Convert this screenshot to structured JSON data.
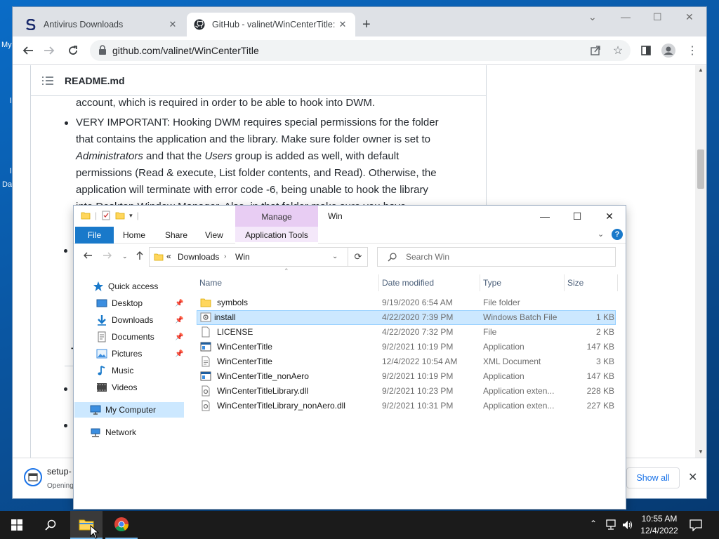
{
  "desktop": {
    "fragments": [
      "My",
      "l",
      "l",
      "Da"
    ]
  },
  "browser": {
    "tabs": [
      {
        "title": "Antivirus Downloads",
        "active": false
      },
      {
        "title": "GitHub - valinet/WinCenterTitle:",
        "active": true
      }
    ],
    "address": "github.com/valinet/WinCenterTitle",
    "readme": {
      "filename": "README.md",
      "lines": [
        "account, which is required in order to be able to hook into DWM.",
        "VERY IMPORTANT: Hooking DWM requires special permissions for the folder",
        "that contains the application and the library. Make sure folder owner is set to",
        "permissions (Read & execute, List folder contents, and Read). Otherwise, the",
        "application will terminate with error code -6, being unable to hook the library"
      ],
      "line3": {
        "em1": "Administrators",
        "mid": " and that the ",
        "em2": "Users",
        "end": " group is added as well, with default"
      },
      "partial_line": "into Desktop Window Manager. Also, in that folder make sure you have",
      "heading_fragment": "To"
    },
    "download": {
      "filename": "setup-",
      "status": "Opening",
      "show_all": "Show all"
    }
  },
  "explorer": {
    "window_title": "Win",
    "context_tab": "Manage",
    "ribbon_tabs": [
      "File",
      "Home",
      "Share",
      "View",
      "Application Tools"
    ],
    "breadcrumb": {
      "overflow": "«",
      "items": [
        "Downloads",
        "Win"
      ]
    },
    "search_placeholder": "Search Win",
    "nav": {
      "quick_access": "Quick access",
      "items": [
        {
          "label": "Desktop",
          "pinned": true
        },
        {
          "label": "Downloads",
          "pinned": true
        },
        {
          "label": "Documents",
          "pinned": true
        },
        {
          "label": "Pictures",
          "pinned": true
        },
        {
          "label": "Music",
          "pinned": false
        },
        {
          "label": "Videos",
          "pinned": false
        }
      ],
      "my_computer": "My Computer",
      "network": "Network"
    },
    "columns": [
      "Name",
      "Date modified",
      "Type",
      "Size"
    ],
    "files": [
      {
        "name": "symbols",
        "date": "9/19/2020 6:54 AM",
        "type": "File folder",
        "size": "",
        "icon": "folder-icon"
      },
      {
        "name": "install",
        "date": "4/22/2020 7:39 PM",
        "type": "Windows Batch File",
        "size": "1 KB",
        "icon": "batch-file-icon",
        "selected": true
      },
      {
        "name": "LICENSE",
        "date": "4/22/2020 7:32 PM",
        "type": "File",
        "size": "2 KB",
        "icon": "file-icon"
      },
      {
        "name": "WinCenterTitle",
        "date": "9/2/2021 10:19 PM",
        "type": "Application",
        "size": "147 KB",
        "icon": "application-icon"
      },
      {
        "name": "WinCenterTitle",
        "date": "12/4/2022 10:54 AM",
        "type": "XML Document",
        "size": "3 KB",
        "icon": "xml-file-icon"
      },
      {
        "name": "WinCenterTitle_nonAero",
        "date": "9/2/2021 10:19 PM",
        "type": "Application",
        "size": "147 KB",
        "icon": "application-icon"
      },
      {
        "name": "WinCenterTitleLibrary.dll",
        "date": "9/2/2021 10:23 PM",
        "type": "Application exten...",
        "size": "228 KB",
        "icon": "dll-file-icon"
      },
      {
        "name": "WinCenterTitleLibrary_nonAero.dll",
        "date": "9/2/2021 10:31 PM",
        "type": "Application exten...",
        "size": "227 KB",
        "icon": "dll-file-icon"
      }
    ]
  },
  "taskbar": {
    "time": "10:55 AM",
    "date": "12/4/2022"
  },
  "colors": {
    "accent": "#1979ca",
    "selection": "#cce8ff",
    "manage_tab": "#e8cdf3",
    "taskbar": "#1b1b1b"
  }
}
